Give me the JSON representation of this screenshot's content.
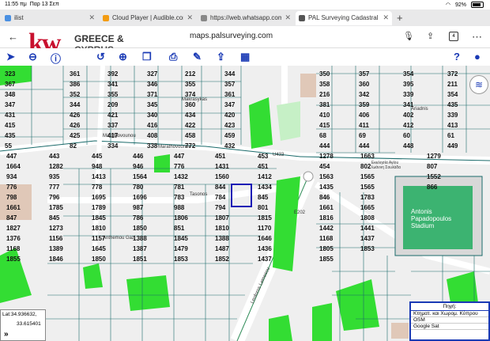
{
  "status": {
    "time": "11:55 πμ",
    "date": "Παρ 13 Σεπ",
    "battery": "92%"
  },
  "tabs": [
    {
      "label": "ilist",
      "color": "#4a90e2",
      "active": false
    },
    {
      "label": "Cloud Player | Audible.com",
      "color": "#f39c12",
      "active": false
    },
    {
      "label": "https://web.whatsapp.com",
      "color": "#888888",
      "active": false
    },
    {
      "label": "PAL Surveying Cadastral",
      "color": "#555555",
      "active": true
    }
  ],
  "address": {
    "url": "maps.palsurveying.com"
  },
  "brand": {
    "logo": "kw",
    "line1": "GREECE &",
    "line2": "CYPRUS"
  },
  "toolbar": {
    "icons": [
      "navigate-icon",
      "zoom-out-icon",
      "info-icon",
      "undo-icon",
      "zoom-in-icon",
      "layers-copy-icon",
      "print-icon",
      "edit-icon",
      "upload-icon",
      "grid-icon",
      "help-icon",
      "user-icon"
    ]
  },
  "map": {
    "parcels": [
      "323",
      "361",
      "392",
      "327",
      "212",
      "344",
      "350",
      "357",
      "354",
      "372",
      "367",
      "386",
      "341",
      "346",
      "355",
      "357",
      "358",
      "360",
      "395",
      "211",
      "348",
      "352",
      "355",
      "371",
      "374",
      "361",
      "216",
      "342",
      "339",
      "354",
      "347",
      "344",
      "209",
      "345",
      "360",
      "347",
      "381",
      "359",
      "341",
      "435",
      "431",
      "426",
      "421",
      "340",
      "434",
      "420",
      "410",
      "406",
      "402",
      "339",
      "415",
      "426",
      "337",
      "416",
      "422",
      "423",
      "415",
      "411",
      "412",
      "413",
      "435",
      "425",
      "417",
      "408",
      "458",
      "459",
      "68",
      "69",
      "60",
      "61",
      "55",
      "82",
      "334",
      "338",
      "772",
      "432",
      "444",
      "444",
      "448",
      "449",
      "447",
      "443",
      "445",
      "446",
      "447",
      "451",
      "453",
      "1278",
      "1663",
      "1279",
      "1664",
      "1282",
      "948",
      "946",
      "776",
      "1431",
      "451",
      "454",
      "802",
      "807",
      "934",
      "935",
      "1413",
      "1564",
      "1432",
      "1560",
      "1412",
      "1563",
      "1565",
      "1552",
      "776",
      "777",
      "778",
      "780",
      "781",
      "844",
      "1434",
      "1435",
      "1565",
      "866",
      "798",
      "796",
      "1695",
      "1696",
      "783",
      "784",
      "845",
      "846",
      "1783",
      "1790",
      "1661",
      "1785",
      "1789",
      "987",
      "988",
      "794",
      "801",
      "1661",
      "1665",
      "849",
      "847",
      "845",
      "1845",
      "786",
      "1806",
      "1807",
      "1815",
      "1816",
      "1808",
      "1816",
      "1827",
      "1273",
      "1810",
      "1850",
      "851",
      "1810",
      "1170",
      "1442",
      "1441",
      "1383",
      "1376",
      "1156",
      "1157",
      "1388",
      "1845",
      "1388",
      "1646",
      "1168",
      "1437",
      "1166",
      "1168",
      "1389",
      "1645",
      "1387",
      "1479",
      "1487",
      "1436",
      "1805",
      "1853",
      "1854",
      "1855",
      "1846",
      "1850",
      "1851",
      "1853",
      "1852",
      "1437",
      "1855"
    ],
    "streets": [
      "Marathovounou",
      "Marathovounou",
      "Tasonos",
      "Anthemou Gazi",
      "Makrasykas",
      "Ariadnis",
      "Leoforos Lemesou",
      "U433",
      "E202"
    ],
    "places": [
      "Antonis Papadopoulos Stadium",
      "Εκκλησία Αγίου Ιωάννη Σουλάδα"
    ]
  },
  "coords": {
    "lat": "Lat:34.936632,",
    "lon": "33.615401"
  },
  "source_panel": {
    "title": "Πηγή:",
    "rows": [
      "Κτηματ. και Χωρομ. Κύπρου",
      "OSM",
      "Google Sat"
    ]
  }
}
